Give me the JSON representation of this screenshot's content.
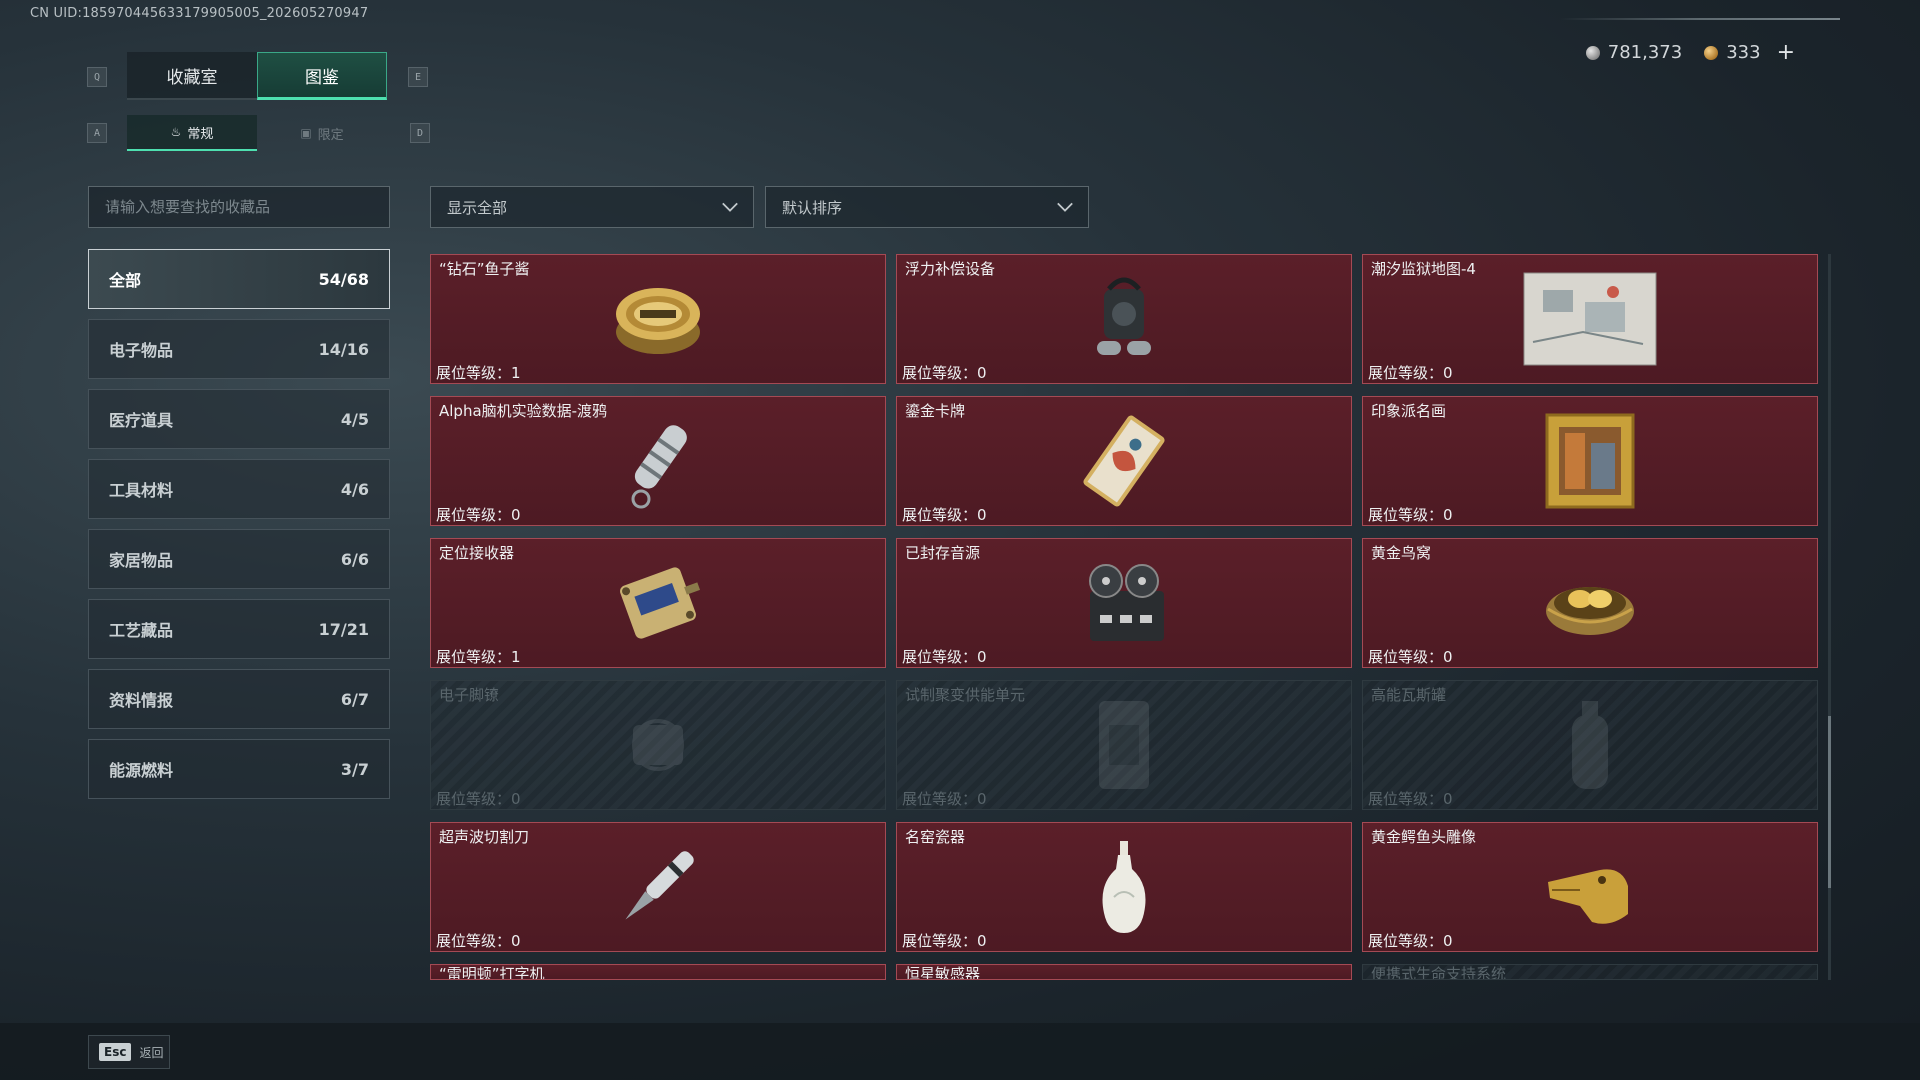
{
  "header": {
    "uid": "CN UID:18597044563317990500​5_202605270947",
    "tabs": [
      {
        "label": "收藏室",
        "active": false
      },
      {
        "label": "图鉴",
        "active": true
      }
    ],
    "tab_key_left": "Q",
    "tab_key_right": "E",
    "subtabs": [
      {
        "label": "常规",
        "icon": "flame-icon",
        "active": true
      },
      {
        "label": "限定",
        "icon": "frame-icon",
        "active": false
      }
    ],
    "subtab_key_left": "A",
    "subtab_key_right": "D",
    "currency": {
      "silver": "781,373",
      "gold": "333"
    }
  },
  "search": {
    "placeholder": "请输入想要查找的收藏品"
  },
  "filters": {
    "show": "显示全部",
    "sort": "默认排序"
  },
  "categories": [
    {
      "label": "全部",
      "count": "54/68"
    },
    {
      "label": "电子物品",
      "count": "14/16"
    },
    {
      "label": "医疗道具",
      "count": "4/5"
    },
    {
      "label": "工具材料",
      "count": "4/6"
    },
    {
      "label": "家居物品",
      "count": "6/6"
    },
    {
      "label": "工艺藏品",
      "count": "17/21"
    },
    {
      "label": "资料情报",
      "count": "6/7"
    },
    {
      "label": "能源燃料",
      "count": "3/7"
    }
  ],
  "items": [
    {
      "name": "“钻石”鱼子酱",
      "level": "展位等级：1",
      "icon": "caviar-icon",
      "locked": false
    },
    {
      "name": "浮力补偿设备",
      "level": "展位等级：0",
      "icon": "buoyancy-device-icon",
      "locked": false
    },
    {
      "name": "潮汐监狱地图-4",
      "level": "展位等级：0",
      "icon": "map-icon",
      "locked": false
    },
    {
      "name": "Alpha脑机实验数据-渡鸦",
      "level": "展位等级：0",
      "icon": "data-cylinder-icon",
      "locked": false
    },
    {
      "name": "鎏金卡牌",
      "level": "展位等级：0",
      "icon": "gilded-card-icon",
      "locked": false
    },
    {
      "name": "印象派名画",
      "level": "展位等级：0",
      "icon": "painting-icon",
      "locked": false
    },
    {
      "name": "定位接收器",
      "level": "展位等级：1",
      "icon": "receiver-icon",
      "locked": false
    },
    {
      "name": "已封存音源",
      "level": "展位等级：0",
      "icon": "tape-recorder-icon",
      "locked": false
    },
    {
      "name": "黄金鸟窝",
      "level": "展位等级：0",
      "icon": "golden-nest-icon",
      "locked": false
    },
    {
      "name": "电子脚镣",
      "level": "展位等级：0",
      "icon": "ankle-monitor-icon",
      "locked": true
    },
    {
      "name": "试制聚变供能单元",
      "level": "展位等级：0",
      "icon": "fusion-unit-icon",
      "locked": true
    },
    {
      "name": "高能瓦斯罐",
      "level": "展位等级：0",
      "icon": "gas-canister-icon",
      "locked": true
    },
    {
      "name": "超声波切割刀",
      "level": "展位等级：0",
      "icon": "ultrasonic-knife-icon",
      "locked": false
    },
    {
      "name": "名窑瓷器",
      "level": "展位等级：0",
      "icon": "porcelain-vase-icon",
      "locked": false
    },
    {
      "name": "黄金鳄鱼头雕像",
      "level": "展位等级：0",
      "icon": "golden-crocodile-icon",
      "locked": false
    },
    {
      "name": "“雷明顿”打字机",
      "level": "",
      "icon": "typewriter-icon",
      "locked": false
    },
    {
      "name": "恒星敏感器",
      "level": "",
      "icon": "star-sensor-icon",
      "locked": false
    },
    {
      "name": "便携式生命支持系统",
      "level": "",
      "icon": "life-support-icon",
      "locked": true
    }
  ],
  "footer": {
    "esc_key": "Esc",
    "esc_label": "返回"
  }
}
